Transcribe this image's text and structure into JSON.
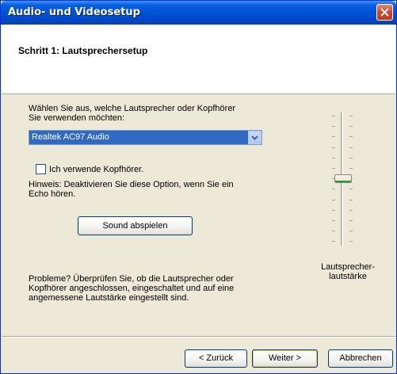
{
  "window": {
    "title": "Audio- und Videosetup"
  },
  "header": {
    "step_title": "Schritt 1: Lautsprechersetup"
  },
  "main": {
    "prompt_line1": "Wählen Sie aus, welche Lautsprecher oder Kopfhörer",
    "prompt_line2": "Sie verwenden möchten:",
    "device_select": {
      "selected": "Realtek AC97 Audio"
    },
    "headphones_checkbox": {
      "label": "Ich verwende Kopfhörer.",
      "checked": false
    },
    "hint_line1": "Hinweis: Deaktivieren Sie diese Option, wenn Sie ein",
    "hint_line2": "Echo hören.",
    "play_sound_label": "Sound abspielen",
    "problem_line1": "Probleme? Überprüfen Sie, ob die Lautsprecher oder",
    "problem_line2": "Kopfhörer angeschlossen, eingeschaltet und auf eine",
    "problem_line3": "angemessene Lautstärke eingestellt sind."
  },
  "volume": {
    "label_line1": "Lautsprecher-",
    "label_line2": "lautstärke",
    "level": 0.5
  },
  "footer": {
    "back_label": "< Zurück",
    "next_label": "Weiter >",
    "cancel_label": "Abbrechen"
  },
  "colors": {
    "titlebar": "#0052d6",
    "selection": "#316ac5",
    "window_bg": "#ece9d8",
    "close": "#d0452a"
  }
}
